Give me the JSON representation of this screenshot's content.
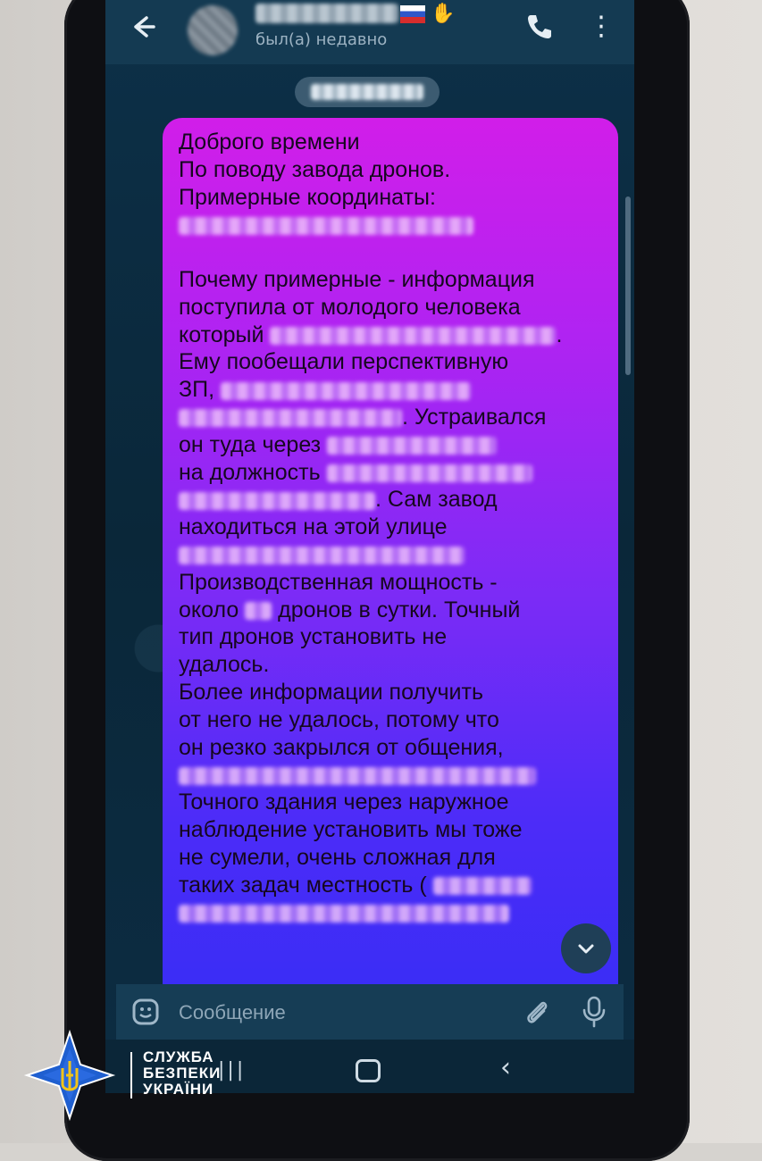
{
  "header": {
    "back_icon": "arrow-left-icon",
    "status": "был(а) недавно",
    "call_icon": "phone-icon",
    "menu_icon": "more-vert-icon"
  },
  "message": {
    "lines": [
      {
        "t": "Доброго времени"
      },
      {
        "t": "По поводу завода дронов."
      },
      {
        "t": "Примерные координаты:"
      },
      {
        "t": "",
        "blur": 330
      },
      {
        "t": ""
      },
      {
        "t": "Почему примерные - информация"
      },
      {
        "t": "поступила от молодого человека"
      },
      {
        "t": "который",
        "blur": 320,
        "after": "."
      },
      {
        "t": "Ему пообещали перспективную"
      },
      {
        "t": "ЗП,",
        "blur": 280
      },
      {
        "t": "",
        "blur": 250,
        "after": ". Устраивался"
      },
      {
        "t": "он туда через",
        "blur": 190
      },
      {
        "t": "на должность",
        "blur": 230
      },
      {
        "t": "",
        "blur": 220,
        "after": ". Сам завод"
      },
      {
        "t": "находиться на этой улице"
      },
      {
        "t": "",
        "blur": 320
      },
      {
        "t": "Производственная мощность -"
      },
      {
        "t": "около",
        "blur": 30,
        "after": " дронов в сутки. Точный"
      },
      {
        "t": "тип дронов установить не"
      },
      {
        "t": "удалось."
      },
      {
        "t": "Более информации получить"
      },
      {
        "t": "от него не удалось, потому что"
      },
      {
        "t": "он резко закрылся от общения,"
      },
      {
        "t": "",
        "blur": 400
      },
      {
        "t": "Точного здания через наружное"
      },
      {
        "t": "наблюдение установить мы тоже"
      },
      {
        "t": "не сумели, очень сложная для"
      },
      {
        "t": "таких задач местность (",
        "blur": 110
      },
      {
        "t": "",
        "blur": 370
      }
    ]
  },
  "composer": {
    "placeholder": "Сообщение",
    "emoji_icon": "sticker-icon",
    "attach_icon": "paperclip-icon",
    "mic_icon": "microphone-icon",
    "scroll_icon": "chevron-down-icon"
  },
  "watermark": {
    "lines": [
      "СЛУЖБА",
      "БЕЗПЕКИ",
      "УКРАЇНИ"
    ]
  }
}
